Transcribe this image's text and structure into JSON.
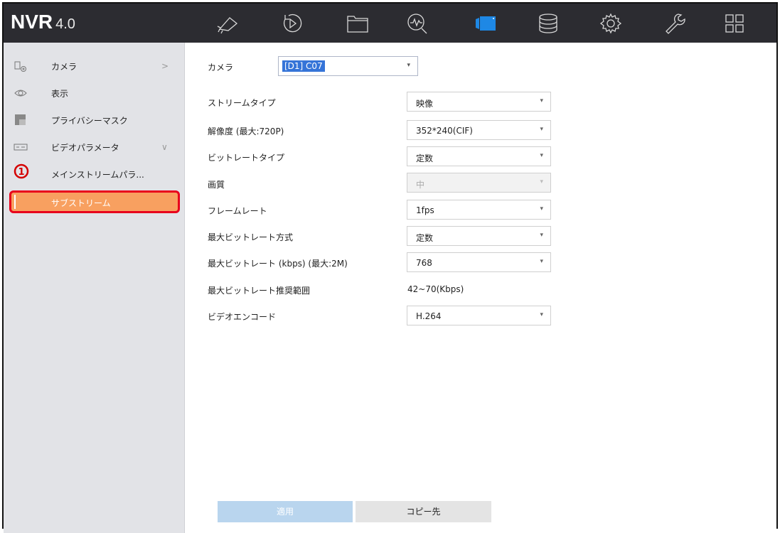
{
  "app": {
    "logo_main": "NVR",
    "logo_version": "4.0"
  },
  "topnav": [
    {
      "name": "live-view-icon"
    },
    {
      "name": "playback-icon"
    },
    {
      "name": "file-management-icon"
    },
    {
      "name": "smart-analysis-icon"
    },
    {
      "name": "camera-icon",
      "active": true
    },
    {
      "name": "storage-icon"
    },
    {
      "name": "system-config-icon"
    },
    {
      "name": "maintenance-icon"
    },
    {
      "name": "grid-menu-icon"
    }
  ],
  "sidebar": {
    "items": [
      {
        "label": "カメラ",
        "chevron": ">"
      },
      {
        "label": "表示"
      },
      {
        "label": "プライバシーマスク"
      },
      {
        "label": "ビデオパラメータ",
        "chevron": "∨"
      },
      {
        "label": "メインストリームパラ..."
      }
    ],
    "active_item": "サブストリーム",
    "annotation": "1"
  },
  "form": {
    "camera_label": "カメラ",
    "camera_value": "[D1] C07",
    "rows": [
      {
        "label": "ストリームタイプ",
        "value": "映像"
      },
      {
        "label": "解像度 (最大:720P)",
        "value": "352*240(CIF)"
      },
      {
        "label": "ビットレートタイプ",
        "value": "定数"
      },
      {
        "label": "画質",
        "value": "中"
      },
      {
        "label": "フレームレート",
        "value": "1fps"
      },
      {
        "label": "最大ビットレート方式",
        "value": "定数"
      },
      {
        "label": "最大ビットレート (kbps) (最大:2M)",
        "value": "768"
      },
      {
        "label": "最大ビットレート推奨範囲",
        "value": "42~70(Kbps)"
      },
      {
        "label": "ビデオエンコード",
        "value": "H.264"
      }
    ]
  },
  "buttons": {
    "apply": "適用",
    "copy_to": "コピー先"
  },
  "colors": {
    "topbar": "#2c2c31",
    "active_nav": "#1e88e5",
    "sidebar_active": "#f8a060",
    "highlight_border": "#e8001c",
    "apply_button": "#b9d5ee"
  }
}
